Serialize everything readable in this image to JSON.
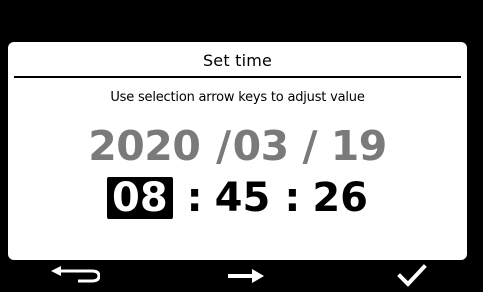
{
  "dialog": {
    "title": "Set time",
    "instruction": "Use selection arrow keys to adjust value"
  },
  "date": {
    "year": "2020",
    "separator_1": " /",
    "month": "03",
    "separator_2": " / ",
    "day": "19"
  },
  "time": {
    "hour": "08",
    "colon_1": ":",
    "minute": "45",
    "colon_2": ":",
    "second": "26",
    "selected_field": "hour"
  },
  "softkeys": [
    {
      "icon": "back-arrow-icon",
      "action": "back"
    },
    {
      "icon": "right-arrow-icon",
      "action": "next"
    },
    {
      "icon": "checkmark-icon",
      "action": "confirm"
    }
  ],
  "colors": {
    "background": "#000000",
    "panel": "#ffffff",
    "date_text": "#7a7a7a",
    "time_text": "#000000",
    "selection_bg": "#000000",
    "selection_fg": "#ffffff"
  }
}
